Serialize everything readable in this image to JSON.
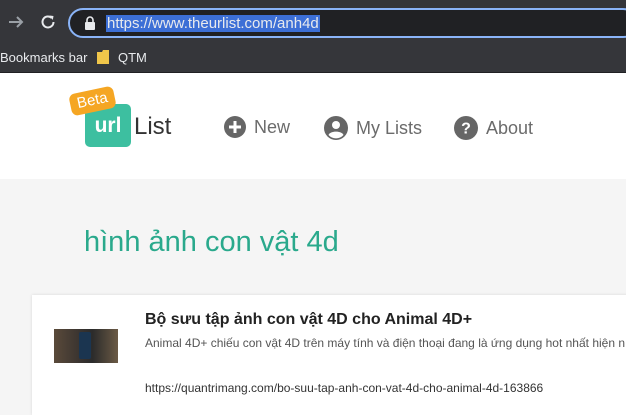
{
  "browser": {
    "url": "https://www.theurlist.com/anh4d",
    "bookmarks_bar_label": "Bookmarks bar",
    "bookmark_folder": "QTM"
  },
  "site": {
    "logo_badge": "Beta",
    "logo_mark": "url",
    "logo_text": "List",
    "nav": {
      "new": "New",
      "my_lists": "My Lists",
      "about": "About"
    }
  },
  "list": {
    "title": "hình ảnh con vật 4d",
    "items": [
      {
        "title": "Bộ sưu tập ảnh con vật 4D cho Animal 4D+",
        "description": "Animal 4D+ chiếu con vật 4D trên máy tính và điện thoại đang là ứng dụng hot nhất hiện n",
        "url": "https://quantrimang.com/bo-suu-tap-anh-con-vat-4d-cho-animal-4d-163866"
      }
    ]
  },
  "colors": {
    "accent": "#2aa98c",
    "logo_bg": "#3dbfa0",
    "beta_bg": "#f5a623",
    "chrome_bg": "#35363a"
  }
}
